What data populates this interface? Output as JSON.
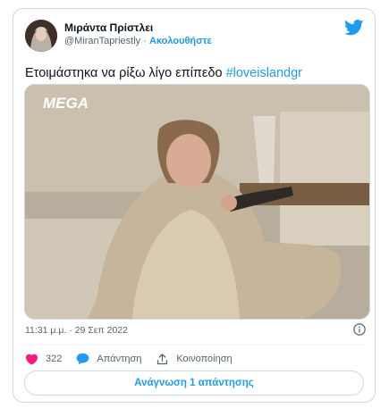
{
  "author": {
    "name": "Μιράντα Πρίστλει",
    "handle": "@MiranTapriestly",
    "separator": "·",
    "follow_label": "Ακολουθήστε"
  },
  "tweet": {
    "text": "Ετοιμάστηκα να ρίξω λίγο επίπεδο",
    "hashtag": "#loveislandgr",
    "timestamp": "11:31 μ.μ. · 29 Σεπ 2022"
  },
  "media": {
    "watermark": "MEGA"
  },
  "actions": {
    "likes": "322",
    "reply_label": "Απάντηση",
    "share_label": "Κοινοποίηση"
  },
  "read_replies_label": "Ανάγνωση 1 απάντησης",
  "colors": {
    "accent": "#1d9bf0",
    "like": "#f91880",
    "secondary_text": "#536471",
    "border": "#cfd9de"
  },
  "icons": [
    "twitter-bird-icon",
    "info-icon",
    "heart-icon",
    "reply-bubble-icon",
    "share-icon"
  ]
}
